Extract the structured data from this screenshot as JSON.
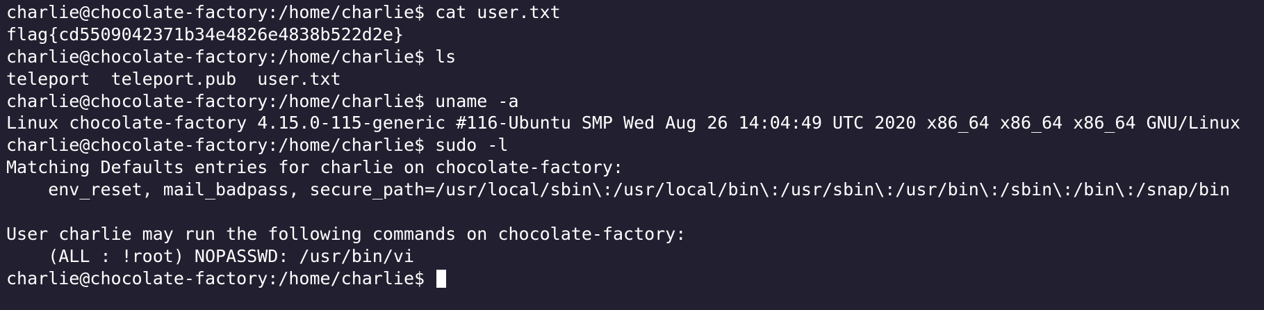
{
  "terminal": {
    "lines": [
      {
        "role": "prompt",
        "text": "charlie@chocolate-factory:/home/charlie$ cat user.txt"
      },
      {
        "role": "output",
        "text": "flag{cd5509042371b34e4826e4838b522d2e}"
      },
      {
        "role": "prompt",
        "text": "charlie@chocolate-factory:/home/charlie$ ls"
      },
      {
        "role": "output",
        "text": "teleport  teleport.pub  user.txt"
      },
      {
        "role": "prompt",
        "text": "charlie@chocolate-factory:/home/charlie$ uname -a"
      },
      {
        "role": "output",
        "text": "Linux chocolate-factory 4.15.0-115-generic #116-Ubuntu SMP Wed Aug 26 14:04:49 UTC 2020 x86_64 x86_64 x86_64 GNU/Linux"
      },
      {
        "role": "prompt",
        "text": "charlie@chocolate-factory:/home/charlie$ sudo -l"
      },
      {
        "role": "output",
        "text": "Matching Defaults entries for charlie on chocolate-factory:"
      },
      {
        "role": "output",
        "text": "    env_reset, mail_badpass, secure_path=/usr/local/sbin\\:/usr/local/bin\\:/usr/sbin\\:/usr/bin\\:/sbin\\:/bin\\:/snap/bin"
      },
      {
        "role": "output",
        "text": ""
      },
      {
        "role": "output",
        "text": "User charlie may run the following commands on chocolate-factory:"
      },
      {
        "role": "output",
        "text": "    (ALL : !root) NOPASSWD: /usr/bin/vi"
      }
    ],
    "current_prompt": "charlie@chocolate-factory:/home/charlie$ "
  }
}
